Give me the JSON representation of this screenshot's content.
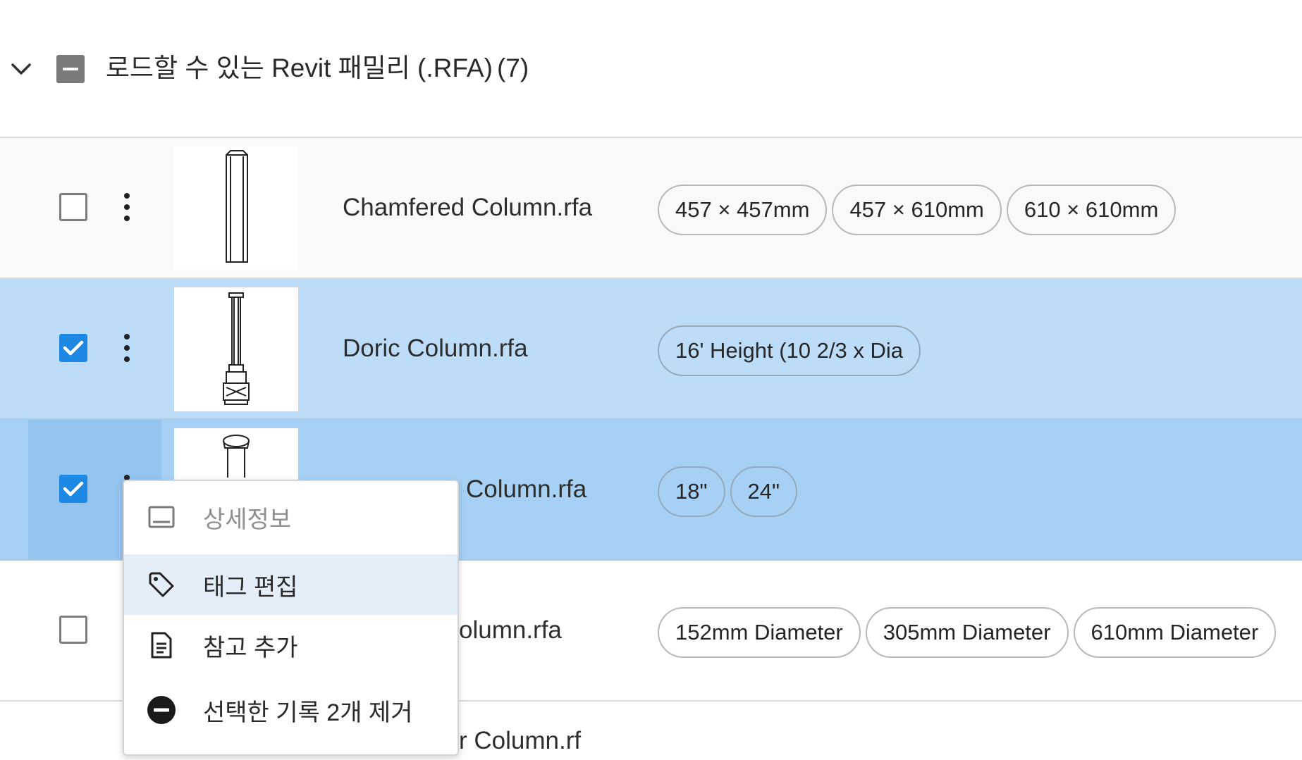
{
  "group": {
    "title": "로드할 수 있는 Revit 패밀리 (.RFA)",
    "count": "(7)"
  },
  "rows": [
    {
      "name": "Chamfered Column.rfa",
      "checked": false,
      "tags": [
        "457 × 457mm",
        "457 × 610mm",
        "610 × 610mm"
      ]
    },
    {
      "name": "Doric Column.rfa",
      "checked": true,
      "tags": [
        "16' Height (10 2/3 x Dia"
      ]
    },
    {
      "name": "Column.rfa",
      "checked": true,
      "tags": [
        "18\"",
        "24\""
      ]
    },
    {
      "name": "olumn.rfa",
      "checked": false,
      "tags": [
        "152mm Diameter",
        "305mm Diameter",
        "610mm Diameter"
      ]
    },
    {
      "name": "r Column.rf",
      "checked": false,
      "tags": []
    }
  ],
  "context_menu": {
    "items": [
      {
        "label": "상세정보",
        "icon": "details-panel-icon",
        "state": "disabled"
      },
      {
        "label": "태그 편집",
        "icon": "tag-icon",
        "state": "hover"
      },
      {
        "label": "참고 추가",
        "icon": "note-icon",
        "state": "normal"
      },
      {
        "label": "선택한 기록 2개 제거",
        "icon": "remove-circle-icon",
        "state": "normal"
      }
    ]
  },
  "colors": {
    "selected_row": "#bcdcf7",
    "active_row": "#a6d1f5",
    "checkbox_checked": "#1e88e5",
    "menu_hover": "#e4eef8"
  }
}
